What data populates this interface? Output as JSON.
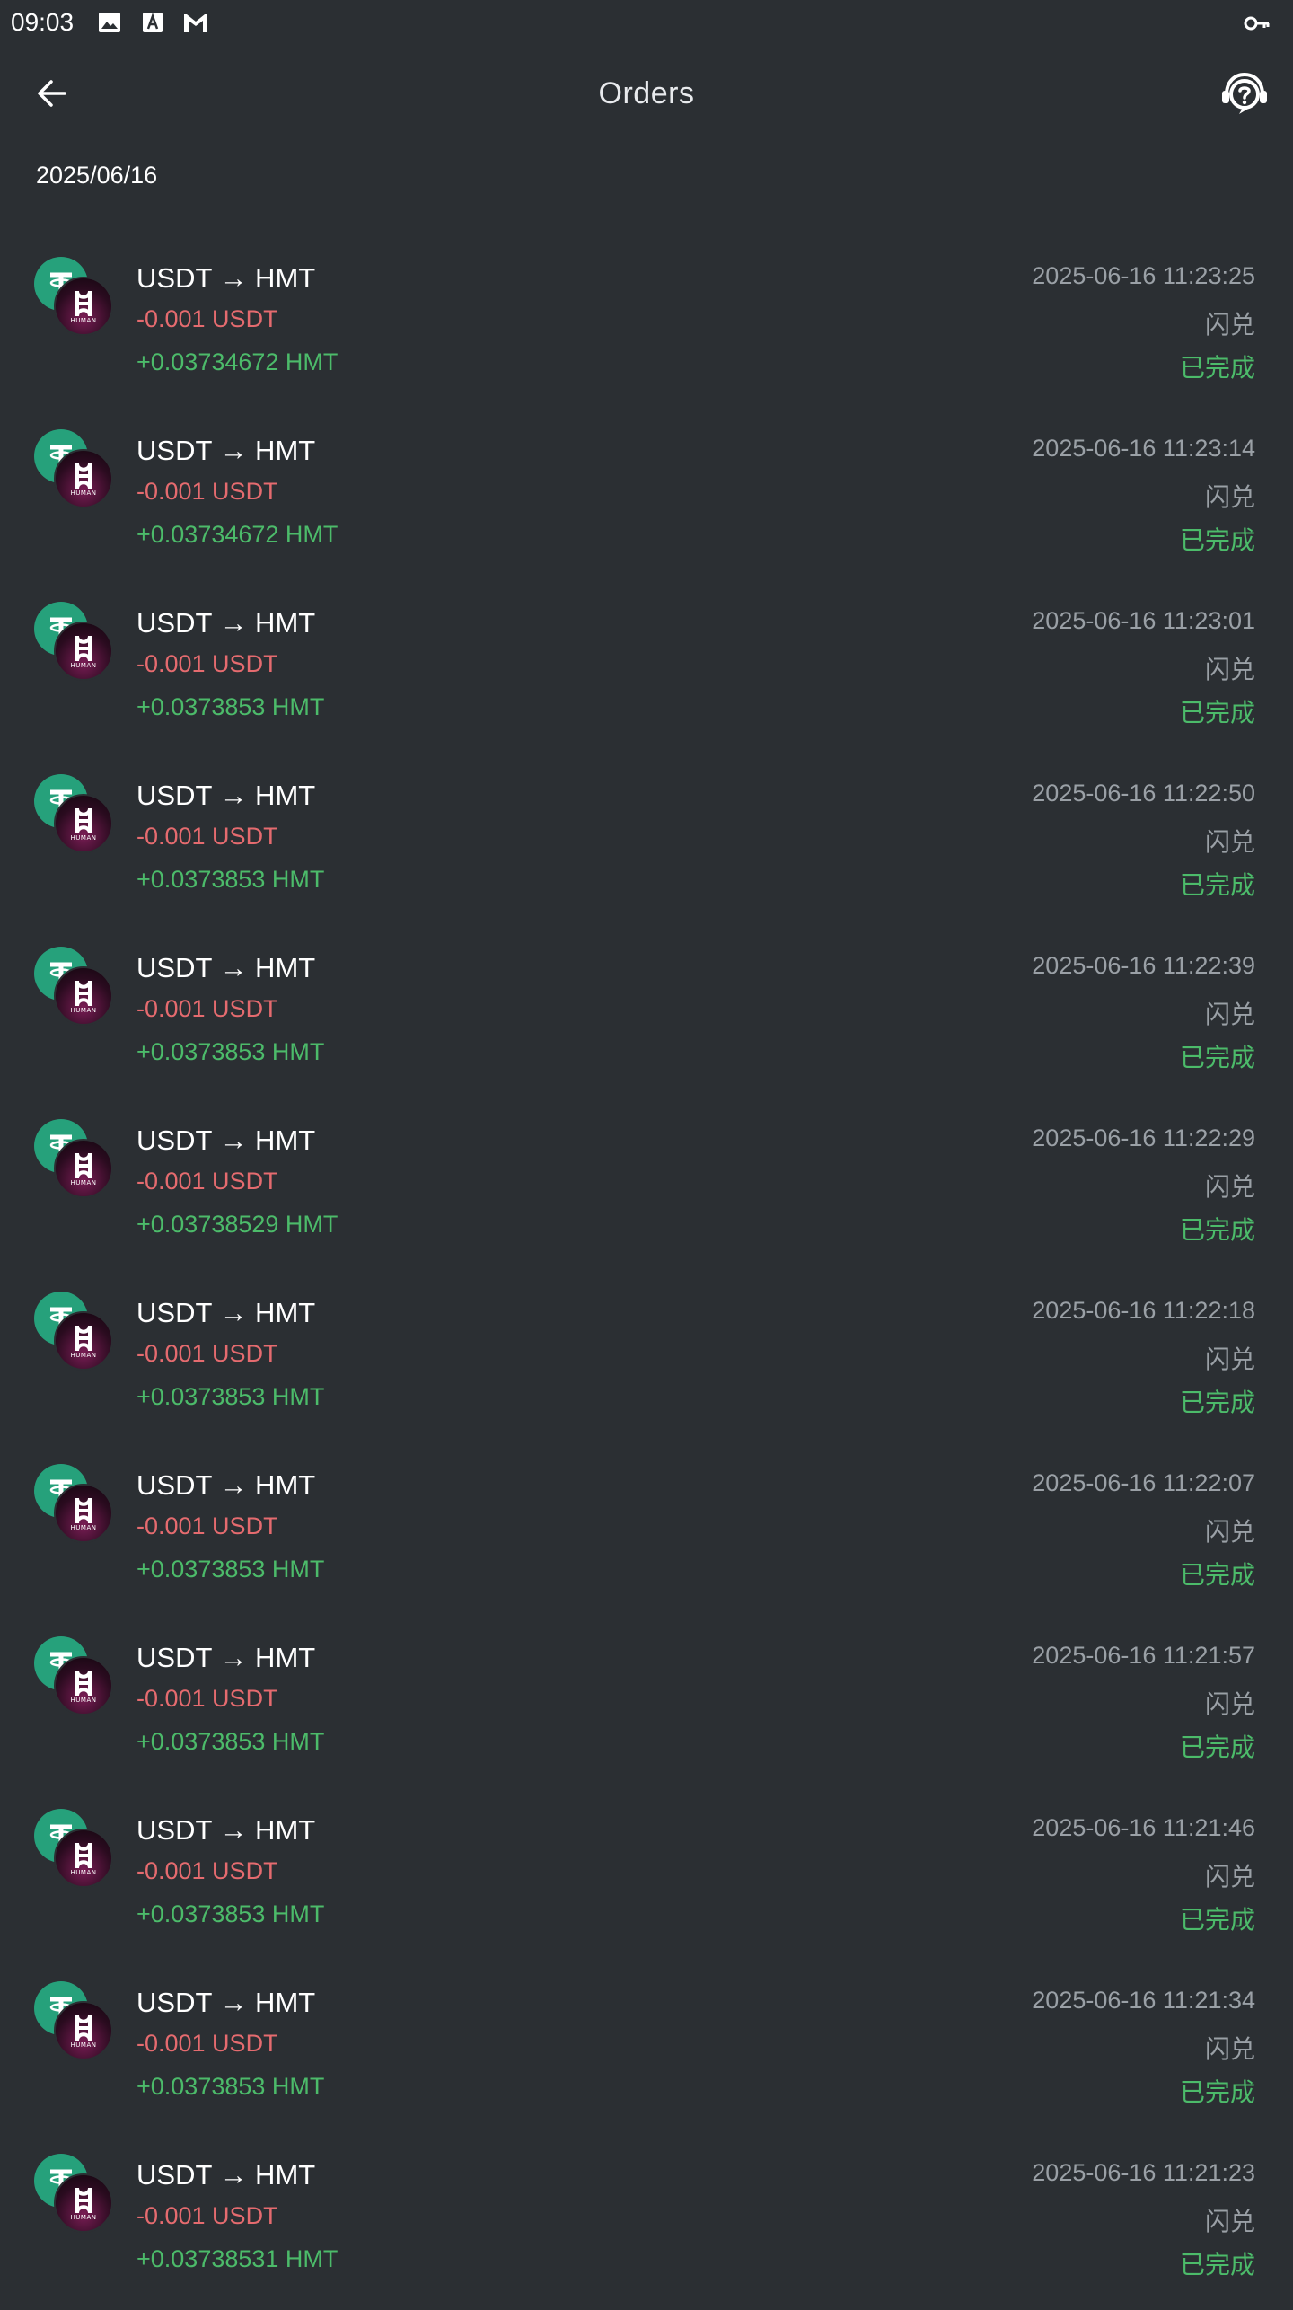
{
  "status_bar": {
    "time": "09:03",
    "icons": [
      "image-icon",
      "font-icon",
      "gmail-icon"
    ],
    "right_icon": "key-icon"
  },
  "app_bar": {
    "title": "Orders",
    "back_icon": "arrow-left-icon",
    "help_icon": "support-headset-icon"
  },
  "date_header": "2025/06/16",
  "colors": {
    "background": "#2b2f33",
    "negative": "#e56b6f",
    "positive": "#4cbb6a",
    "muted": "#9aa0a6",
    "usdt_green": "#26a17b"
  },
  "orders": [
    {
      "pair": "USDT → HMT",
      "out": "-0.001 USDT",
      "in": "+0.03734672 HMT",
      "time": "2025-06-16 11:23:25",
      "type": "闪兑",
      "status": "已完成"
    },
    {
      "pair": "USDT → HMT",
      "out": "-0.001 USDT",
      "in": "+0.03734672 HMT",
      "time": "2025-06-16 11:23:14",
      "type": "闪兑",
      "status": "已完成"
    },
    {
      "pair": "USDT → HMT",
      "out": "-0.001 USDT",
      "in": "+0.0373853 HMT",
      "time": "2025-06-16 11:23:01",
      "type": "闪兑",
      "status": "已完成"
    },
    {
      "pair": "USDT → HMT",
      "out": "-0.001 USDT",
      "in": "+0.0373853 HMT",
      "time": "2025-06-16 11:22:50",
      "type": "闪兑",
      "status": "已完成"
    },
    {
      "pair": "USDT → HMT",
      "out": "-0.001 USDT",
      "in": "+0.0373853 HMT",
      "time": "2025-06-16 11:22:39",
      "type": "闪兑",
      "status": "已完成"
    },
    {
      "pair": "USDT → HMT",
      "out": "-0.001 USDT",
      "in": "+0.03738529 HMT",
      "time": "2025-06-16 11:22:29",
      "type": "闪兑",
      "status": "已完成"
    },
    {
      "pair": "USDT → HMT",
      "out": "-0.001 USDT",
      "in": "+0.0373853 HMT",
      "time": "2025-06-16 11:22:18",
      "type": "闪兑",
      "status": "已完成"
    },
    {
      "pair": "USDT → HMT",
      "out": "-0.001 USDT",
      "in": "+0.0373853 HMT",
      "time": "2025-06-16 11:22:07",
      "type": "闪兑",
      "status": "已完成"
    },
    {
      "pair": "USDT → HMT",
      "out": "-0.001 USDT",
      "in": "+0.0373853 HMT",
      "time": "2025-06-16 11:21:57",
      "type": "闪兑",
      "status": "已完成"
    },
    {
      "pair": "USDT → HMT",
      "out": "-0.001 USDT",
      "in": "+0.0373853 HMT",
      "time": "2025-06-16 11:21:46",
      "type": "闪兑",
      "status": "已完成"
    },
    {
      "pair": "USDT → HMT",
      "out": "-0.001 USDT",
      "in": "+0.0373853 HMT",
      "time": "2025-06-16 11:21:34",
      "type": "闪兑",
      "status": "已完成"
    },
    {
      "pair": "USDT → HMT",
      "out": "-0.001 USDT",
      "in": "+0.03738531 HMT",
      "time": "2025-06-16 11:21:23",
      "type": "闪兑",
      "status": "已完成"
    }
  ]
}
